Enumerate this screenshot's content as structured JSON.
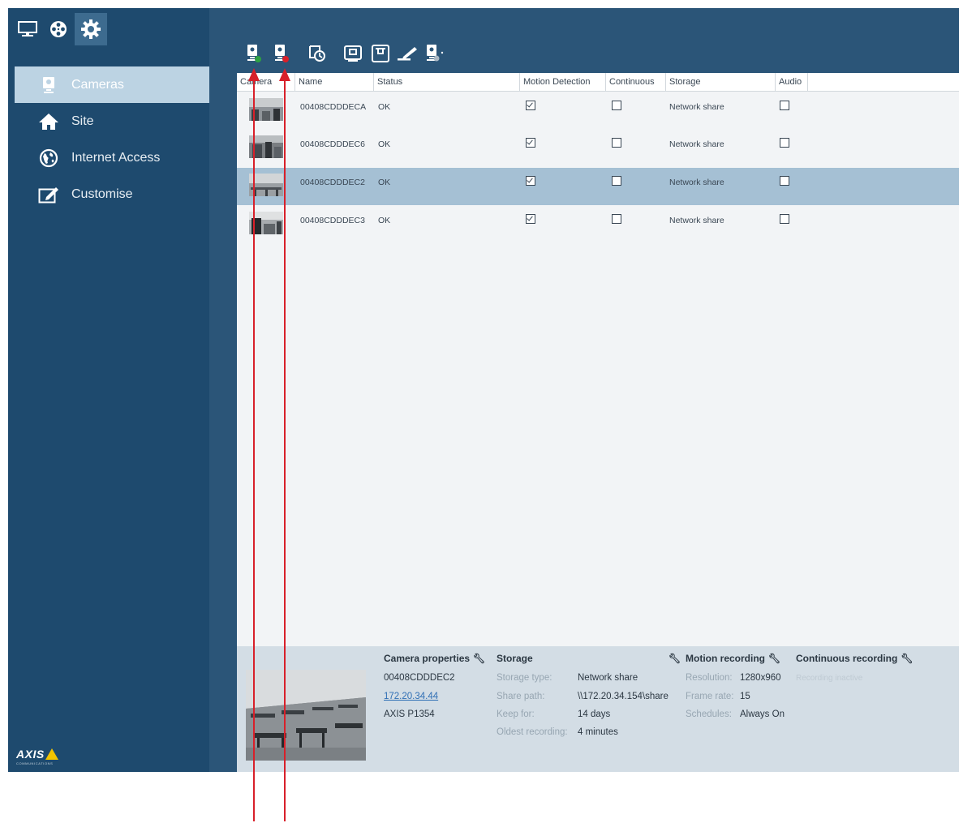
{
  "sidebar": {
    "items": [
      {
        "label": "Cameras",
        "icon": "camera-icon"
      },
      {
        "label": "Site",
        "icon": "home-icon"
      },
      {
        "label": "Internet Access",
        "icon": "globe-icon"
      },
      {
        "label": "Customise",
        "icon": "customise-icon"
      }
    ],
    "logo_text": "AXIS",
    "logo_subtext": "COMMUNICATIONS"
  },
  "table": {
    "columns": [
      "Camera",
      "Name",
      "Status",
      "Motion Detection",
      "Continuous",
      "Storage",
      "Audio"
    ],
    "rows": [
      {
        "name": "00408CDDDECA",
        "status": "OK",
        "motion": true,
        "continuous": false,
        "storage": "Network share",
        "audio": false
      },
      {
        "name": "00408CDDDEC6",
        "status": "OK",
        "motion": true,
        "continuous": false,
        "storage": "Network share",
        "audio": false
      },
      {
        "name": "00408CDDDEC2",
        "status": "OK",
        "motion": true,
        "continuous": false,
        "storage": "Network share",
        "audio": false,
        "selected": true
      },
      {
        "name": "00408CDDDEC3",
        "status": "OK",
        "motion": true,
        "continuous": false,
        "storage": "Network share",
        "audio": false
      }
    ]
  },
  "details": {
    "camera_properties": {
      "title": "Camera properties",
      "name": "00408CDDDEC2",
      "ip": "172.20.34.44",
      "model": "AXIS P1354"
    },
    "storage": {
      "title": "Storage",
      "type_label": "Storage type:",
      "type_value": "Network share",
      "path_label": "Share path:",
      "path_value": "\\\\172.20.34.154\\share",
      "keep_label": "Keep for:",
      "keep_value": "14 days",
      "oldest_label": "Oldest recording:",
      "oldest_value": "4 minutes"
    },
    "motion_recording": {
      "title": "Motion recording",
      "resolution_label": "Resolution:",
      "resolution_value": "1280x960",
      "framerate_label": "Frame rate:",
      "framerate_value": "15",
      "schedules_label": "Schedules:",
      "schedules_value": "Always On"
    },
    "continuous_recording": {
      "title": "Continuous recording",
      "status": "Recording inactive"
    }
  },
  "colors": {
    "sidebar_bg": "#1e4a6e",
    "header_bg": "#2b5578",
    "selected_row": "#a5c0d4",
    "nav_selected": "#bcd3e3",
    "annotation_arrow": "#d8202a"
  }
}
